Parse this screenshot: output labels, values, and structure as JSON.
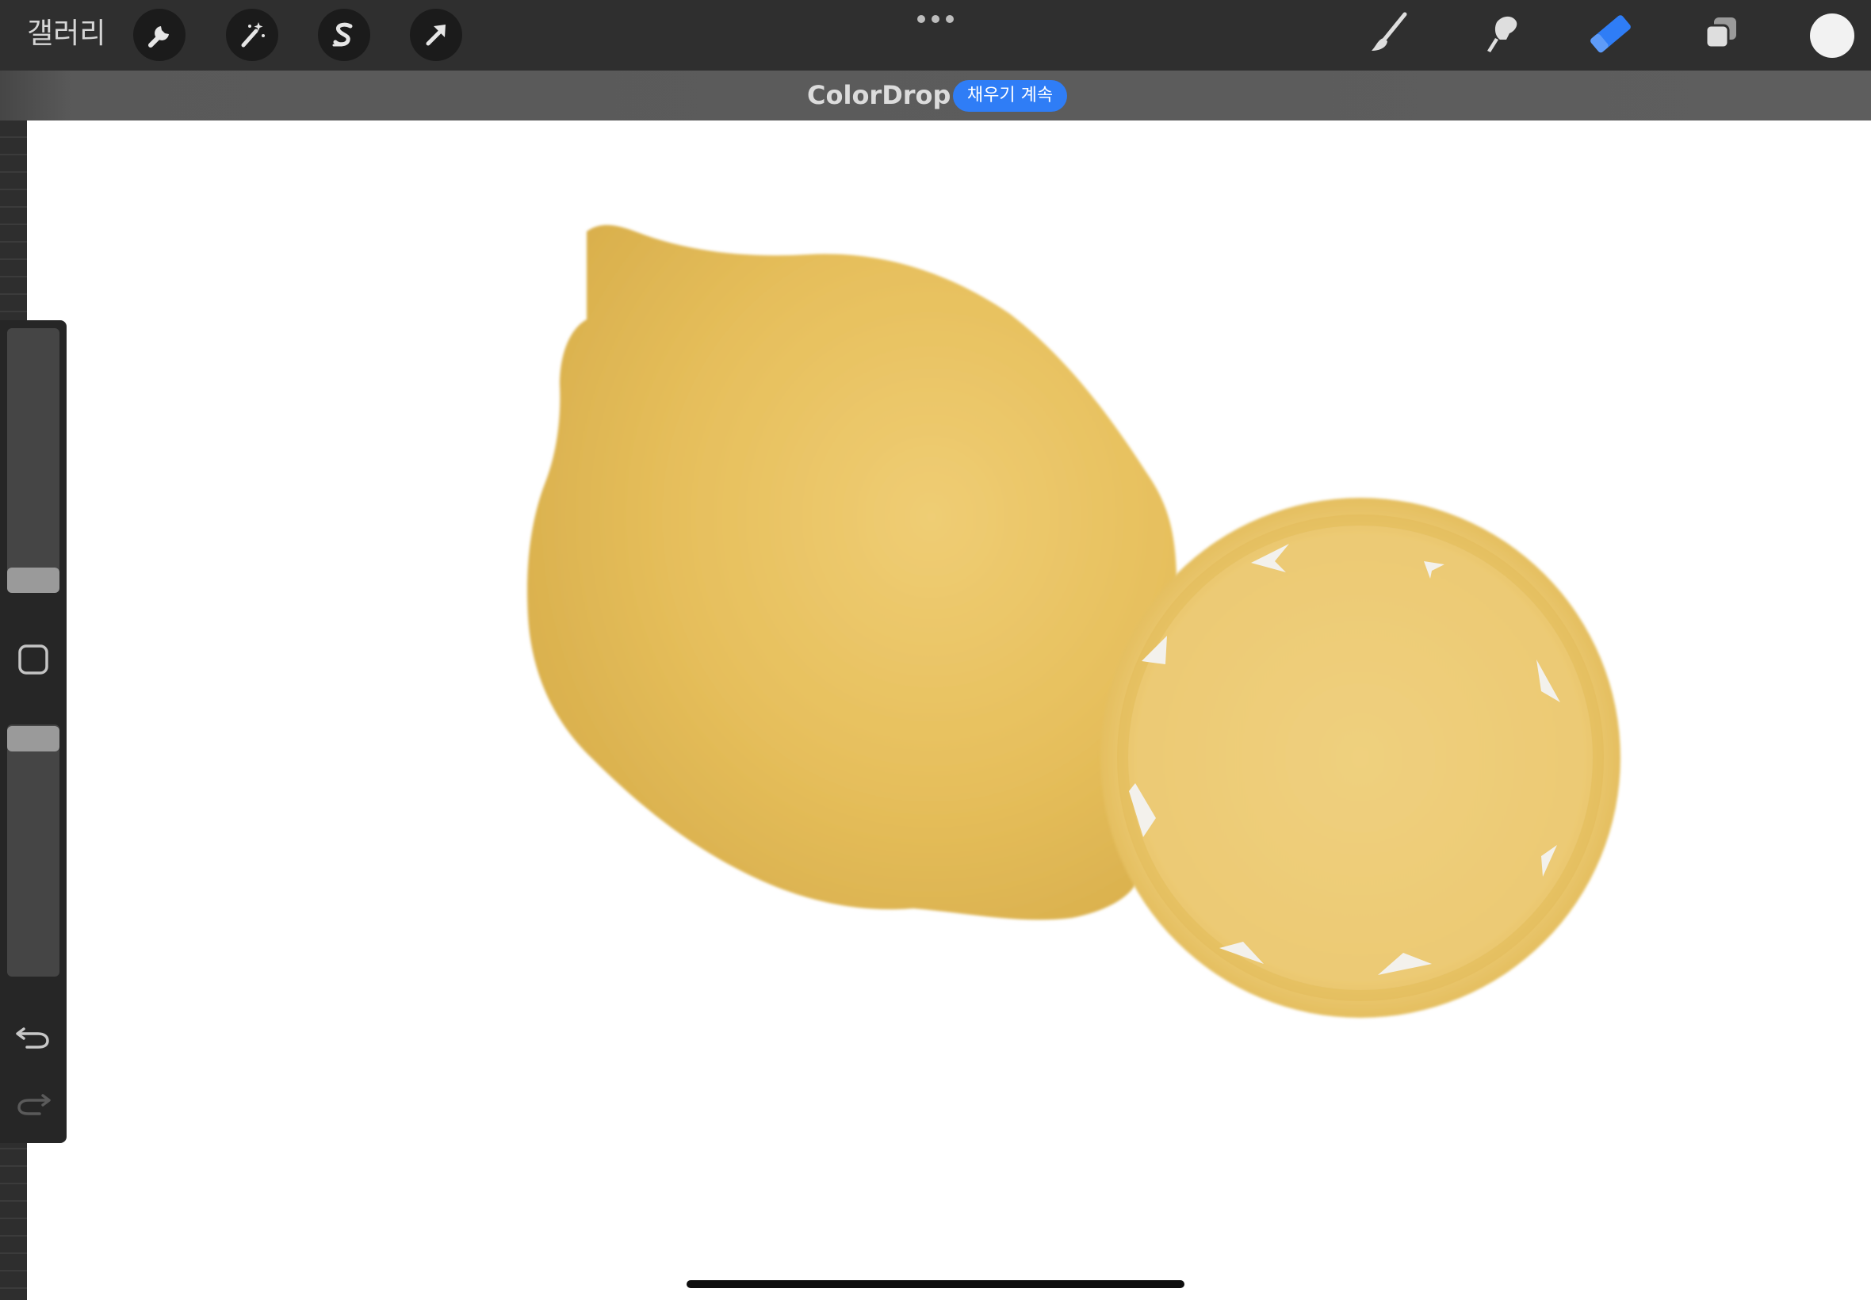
{
  "app": {
    "gallery_label": "갤러리",
    "accent_color": "#2f7df6"
  },
  "toolbar": {
    "left_tools": [
      "wrench-icon",
      "magic-wand-icon",
      "selection-s-icon",
      "transform-arrow-icon"
    ],
    "right_tools": [
      "brush-icon",
      "smudge-icon",
      "eraser-icon",
      "layers-icon"
    ],
    "active_tool": "eraser-icon",
    "current_color": "#f2f2f2"
  },
  "status": {
    "title": "ColorDrop",
    "action_label": "채우기 계속"
  },
  "sidebar": {
    "controls": [
      "brush-size-slider",
      "modify-button",
      "opacity-slider",
      "undo-icon",
      "redo-icon"
    ]
  },
  "canvas": {
    "background": "#ffffff",
    "fill_colors": [
      "#e6bf5a",
      "#edcd78",
      "#d8b04e"
    ]
  }
}
